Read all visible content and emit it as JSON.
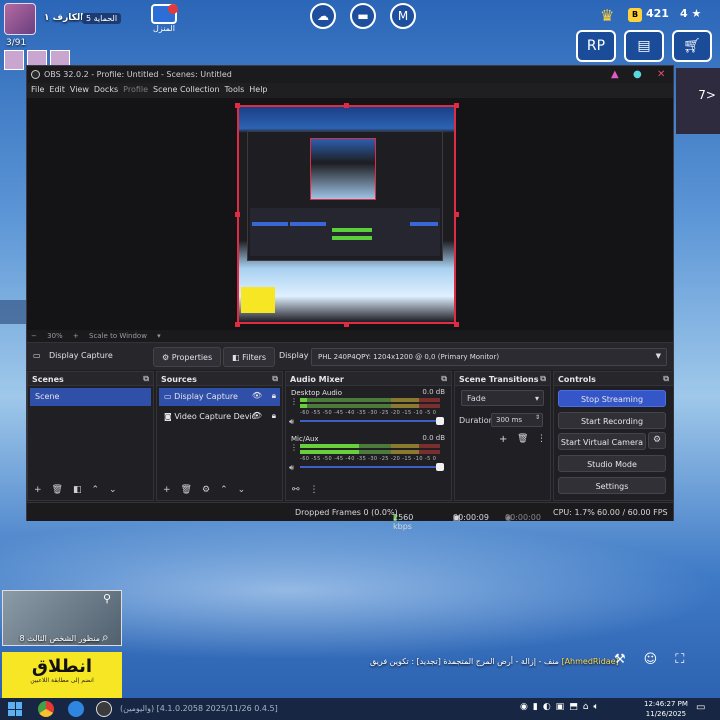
{
  "game_hud": {
    "player_name": "الكارف ١",
    "level": "الحماية 5",
    "home_label": "المنزل",
    "vbucks": "421",
    "stars": "4",
    "party_count": "3/91",
    "side_arrow": "7>",
    "minimap_label": "منظور الشخص الثالث 8",
    "go_title": "انطلاق",
    "go_subtitle": "انضم إلى مطابقة اللاعبين",
    "chat_player": "[AhmedRidae]",
    "chat_text": "منف - إزالة - أرض المرج المتجمدة [تجديد] : تكوين فريق"
  },
  "obs": {
    "title": "OBS 32.0.2 - Profile: Untitled - Scenes: Untitled",
    "menu": [
      "File",
      "Edit",
      "View",
      "Docks",
      "Profile",
      "Scene Collection",
      "Tools",
      "Help"
    ],
    "zoom": {
      "minus": "−",
      "percent": "30%",
      "plus": "+",
      "mode": "Scale to Window"
    },
    "source_toolbar": {
      "source_name": "Display Capture",
      "properties": "Properties",
      "filters": "Filters",
      "display_label": "Display",
      "display_value": "PHL 240P4QPY: 1204x1200 @ 0,0 (Primary Monitor)"
    },
    "scenes": {
      "title": "Scenes",
      "items": [
        "Scene"
      ]
    },
    "sources": {
      "title": "Sources",
      "items": [
        "Display Capture",
        "Video Capture Devic"
      ]
    },
    "mixer": {
      "title": "Audio Mixer",
      "tracks": [
        {
          "name": "Desktop Audio",
          "db": "0.0 dB",
          "level": 0.05
        },
        {
          "name": "Mic/Aux",
          "db": "0.0 dB",
          "level": 0.42
        }
      ],
      "scale": "-60 -55 -50 -45 -40 -35 -30 -25 -20 -15 -10 -5 0"
    },
    "transitions": {
      "title": "Scene Transitions",
      "type": "Fade",
      "duration_label": "Duration",
      "duration": "300 ms"
    },
    "controls": {
      "title": "Controls",
      "stop_streaming": "Stop Streaming",
      "start_recording": "Start Recording",
      "start_virtual_camera": "Start Virtual Camera",
      "studio_mode": "Studio Mode",
      "settings": "Settings"
    },
    "status": {
      "dropped_frames": "Dropped Frames 0 (0.0%)",
      "bitrate": "2560 kbps",
      "stream_time": "00:00:09",
      "record_time": "00:00:00",
      "cpu": "CPU: 1.7%",
      "fps": "60.00 / 60.00 FPS"
    }
  },
  "taskbar": {
    "ticker": "(واليومين) [0.4.5 2025/11/26 4.1.0.2058]",
    "time": "12:46:27 PM",
    "date": "11/26/2025"
  },
  "colors": {
    "accent": "#3556c9",
    "selection_red": "#e02b45",
    "obs_bg": "#1f1f22",
    "go_yellow": "#f6e623"
  }
}
